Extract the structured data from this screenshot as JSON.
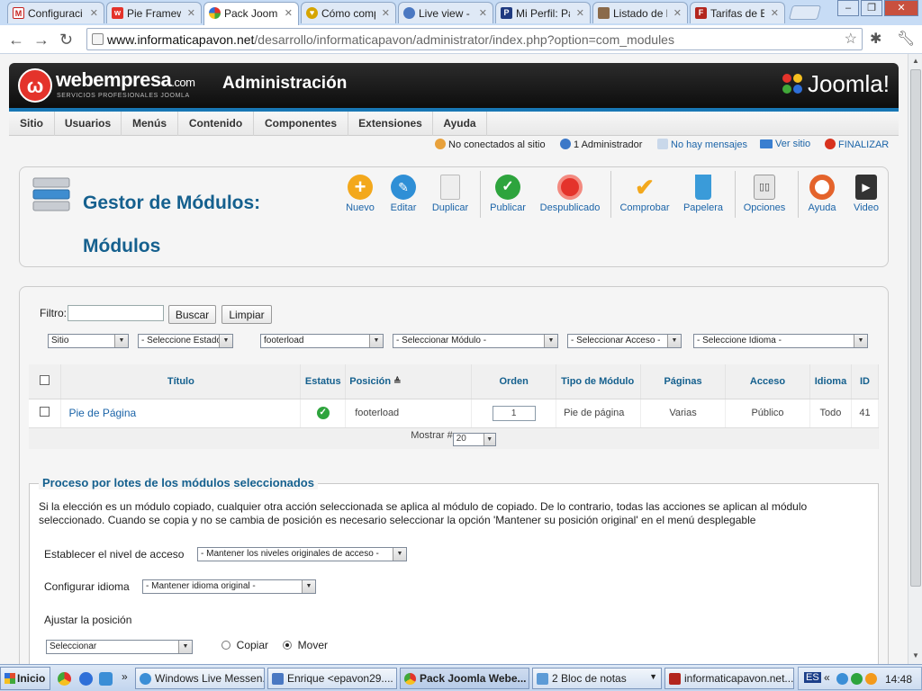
{
  "browser": {
    "tabs": [
      {
        "label": "Configuració",
        "favicon": "gmail-icon",
        "color": "#c5221f"
      },
      {
        "label": "Pie Framewo",
        "favicon": "webempresa-icon",
        "color": "#e4332b"
      },
      {
        "label": "Pack Joomla",
        "favicon": "joomla-icon",
        "color": "#e4332b"
      },
      {
        "label": "Cómo compr",
        "favicon": "heart-icon",
        "color": "#d6a500"
      },
      {
        "label": "Live view - ",
        "favicon": "globe-icon",
        "color": "#4a78c2"
      },
      {
        "label": "Mi Perfil: Pa",
        "favicon": "paypal-icon",
        "color": "#1f3a80"
      },
      {
        "label": "Listado de b",
        "favicon": "user-photo-icon",
        "color": "#8a6a4a"
      },
      {
        "label": "Tarifas de E",
        "favicon": "filezilla-icon",
        "color": "#b3261e"
      }
    ],
    "window_buttons": {
      "minimize": "–",
      "restore": "❐",
      "close": "✕"
    },
    "url_domain": "www.informaticapavon.net",
    "url_path": "/desarrollo/informaticapavon/administrator/index.php?option=com_modules"
  },
  "header": {
    "brand": "webempresa",
    "brand_domain": ".com",
    "tagline": "SERVICIOS PROFESIONALES JOOMLA",
    "title": "Administración",
    "joomla": "Joomla!"
  },
  "menu": [
    "Sitio",
    "Usuarios",
    "Menús",
    "Contenido",
    "Componentes",
    "Extensiones",
    "Ayuda"
  ],
  "status": {
    "offline": "No conectados al sitio",
    "admins": "1 Administrador",
    "messages": "No hay mensajes",
    "view_site": "Ver sitio",
    "logout": "FINALIZAR"
  },
  "page": {
    "title_line1": "Gestor de Módulos:",
    "title_line2": "Módulos"
  },
  "toolbar": [
    {
      "label": "Nuevo",
      "icon": "plus-icon",
      "color": "#f3a81c"
    },
    {
      "label": "Editar",
      "icon": "pencil-icon",
      "color": "#2f8fd6"
    },
    {
      "label": "Duplicar",
      "icon": "copy-icon",
      "color": "#cccccc"
    },
    {
      "label": "Publicar",
      "icon": "check-circle-icon",
      "color": "#2ea43d"
    },
    {
      "label": "Despublicado",
      "icon": "stop-circle-icon",
      "color": "#e4332b"
    },
    {
      "label": "Comprobar",
      "icon": "checkmark-icon",
      "color": "#f3a81c"
    },
    {
      "label": "Papelera",
      "icon": "trash-icon",
      "color": "#3a9bd9"
    },
    {
      "label": "Opciones",
      "icon": "options-icon",
      "color": "#888888"
    },
    {
      "label": "Ayuda",
      "icon": "lifebuoy-icon",
      "color": "#e4632b"
    },
    {
      "label": "Video",
      "icon": "video-icon",
      "color": "#333333"
    }
  ],
  "filters": {
    "label": "Filtro:",
    "search_button": "Buscar",
    "clear_button": "Limpiar",
    "selects": [
      "Sitio",
      "- Seleccione Estado -",
      "footerload",
      "- Seleccionar Módulo -",
      "- Seleccionar Acceso -",
      "- Seleccione Idioma -"
    ]
  },
  "table": {
    "headers": [
      "Título",
      "Estatus",
      "Posición",
      "Orden",
      "Tipo de Módulo",
      "Páginas",
      "Acceso",
      "Idioma",
      "ID"
    ],
    "rows": [
      {
        "title": "Pie de Página",
        "position": "footerload",
        "order": "1",
        "type": "Pie de página",
        "pages": "Varias",
        "access": "Público",
        "language": "Todo",
        "id": "41"
      }
    ],
    "show_label": "Mostrar #",
    "show_value": "20"
  },
  "batch": {
    "legend": "Proceso por lotes de los módulos seleccionados",
    "description": "Si la elección es un módulo copiado, cualquier otra acción seleccionada se aplica al módulo de copiado. De lo contrario, todas las acciones se aplican al módulo seleccionado. Cuando se copia y no se cambia de posición es necesario seleccionar la opción 'Mantener su posición original' en el menú desplegable",
    "access_label": "Establecer el nivel de acceso",
    "access_value": "- Mantener los niveles originales de acceso -",
    "lang_label": "Configurar idioma",
    "lang_value": "- Mantener idioma original -",
    "position_label": "Ajustar la posición",
    "position_value": "Seleccionar",
    "copy_label": "Copiar",
    "move_label": "Mover"
  },
  "taskbar": {
    "start": "Inicio",
    "more": "»",
    "tasks": [
      {
        "label": "Windows Live Messen...",
        "color": "#3b8ed6"
      },
      {
        "label": "Enrique <epavon29....",
        "color": "#4a78c2"
      },
      {
        "label": "Pack Joomla Webe...",
        "color": "#e4332b"
      },
      {
        "label": "2 Bloc de notas",
        "color": "#5d9bd6"
      },
      {
        "label": "informaticapavon.net...",
        "color": "#b3261e"
      }
    ],
    "tray_prefix": "ES",
    "tray_more": "«",
    "clock": "14:48"
  }
}
